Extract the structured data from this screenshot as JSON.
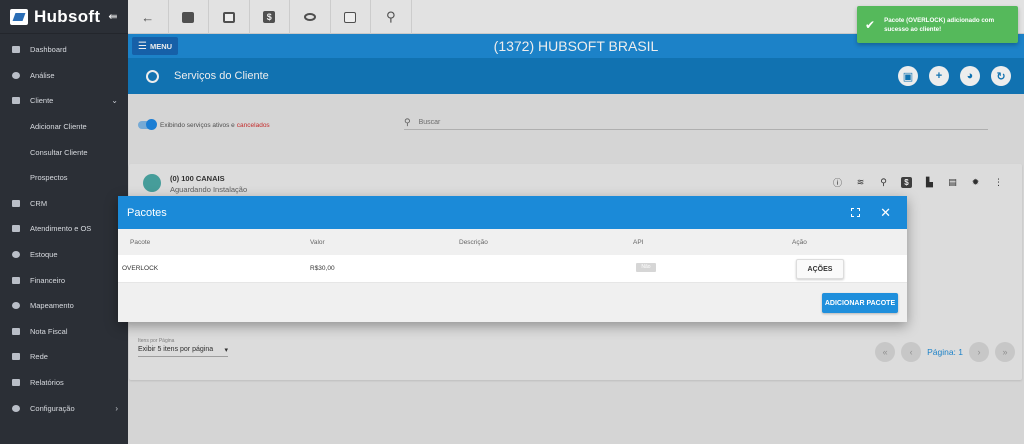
{
  "sidebar": {
    "logo": "Hubsoft",
    "items": [
      {
        "label": "Dashboard",
        "icon": "dashboard-icon"
      },
      {
        "label": "Análise",
        "icon": "chart-pie-icon"
      },
      {
        "label": "Cliente",
        "icon": "client-icon"
      },
      {
        "label": "Adicionar Cliente"
      },
      {
        "label": "Consultar Cliente"
      },
      {
        "label": "Prospectos"
      },
      {
        "label": "CRM",
        "icon": "crm-icon"
      },
      {
        "label": "Atendimento e OS",
        "icon": "calendar-icon"
      },
      {
        "label": "Estoque",
        "icon": "box-icon"
      },
      {
        "label": "Financeiro",
        "icon": "money-icon"
      },
      {
        "label": "Mapeamento",
        "icon": "map-icon"
      },
      {
        "label": "Nota Fiscal",
        "icon": "invoice-icon"
      },
      {
        "label": "Rede",
        "icon": "server-icon"
      },
      {
        "label": "Relatórios",
        "icon": "report-icon"
      },
      {
        "label": "Configuração",
        "icon": "gear-icon"
      }
    ]
  },
  "topbar": {
    "icons": [
      "back-arrow-icon",
      "contact-card-icon",
      "calendar-clock-icon",
      "dollar-icon",
      "eye-icon",
      "terminal-icon",
      "search-icon"
    ]
  },
  "header": {
    "menu_label": "MENU",
    "company": "(1372) HUBSOFT BRASIL"
  },
  "services": {
    "title": "Serviços do Cliente",
    "filter_text": "Exibindo serviços ativos e",
    "filter_cancel": "cancelados",
    "search_placeholder": "Buscar"
  },
  "service_card": {
    "name": "(0) 100 CANAIS",
    "status": "Aguardando Instalação"
  },
  "pagination": {
    "per_page_label": "Itens por Página",
    "per_page_value": "Exibir 5 itens por página",
    "page_text": "Página: 1"
  },
  "modal": {
    "title": "Pacotes",
    "columns": [
      "Pacote",
      "Valor",
      "Descrição",
      "API",
      "Ação"
    ],
    "rows": [
      {
        "pacote": "OVERLOCK",
        "valor": "R$30,00",
        "descricao": "",
        "api": "Não",
        "acao": "AÇÕES"
      }
    ],
    "add_button": "ADICIONAR PACOTE"
  },
  "toast": {
    "message": "Pacote (OVERLOCK) adicionado com sucesso ao cliente!",
    "color": "#55b95b"
  },
  "colors": {
    "primary": "#1f8cd8",
    "sidebar": "#2b2f36",
    "cancel_text": "#d32f2f"
  }
}
